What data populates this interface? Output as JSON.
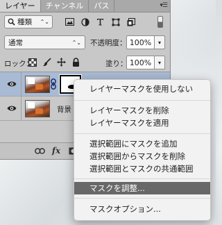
{
  "tabs": [
    {
      "label": "レイヤー",
      "active": true
    },
    {
      "label": "チャンネル",
      "active": false
    },
    {
      "label": "パス",
      "active": false
    }
  ],
  "panel_menu_glyph": "▾☰",
  "filter": {
    "kind_label": "種類",
    "chevron": "⌃⌄"
  },
  "blend": {
    "mode": "通常",
    "chevron": "⌃⌄"
  },
  "opacity": {
    "label": "不透明度：",
    "value": "100%",
    "drop": "▾"
  },
  "lock": {
    "label": "ロック："
  },
  "fill": {
    "label": "塗り：",
    "value": "100%",
    "drop": "▾"
  },
  "layers": [
    {
      "name": "",
      "selected": true,
      "has_mask": true
    },
    {
      "name": "背景",
      "selected": false,
      "has_mask": false
    }
  ],
  "context_menu": {
    "items": [
      "レイヤーマスクを使用しない",
      "レイヤーマスクを削除",
      "レイヤーマスクを適用",
      "選択範囲にマスクを追加",
      "選択範囲からマスクを削除",
      "選択範囲とマスクの共通範囲",
      "マスクを調整...",
      "マスクオプション..."
    ],
    "highlighted_index": 6
  },
  "colors": {
    "selected_layer": "#a9bad4",
    "menu_highlight": "#686868"
  }
}
